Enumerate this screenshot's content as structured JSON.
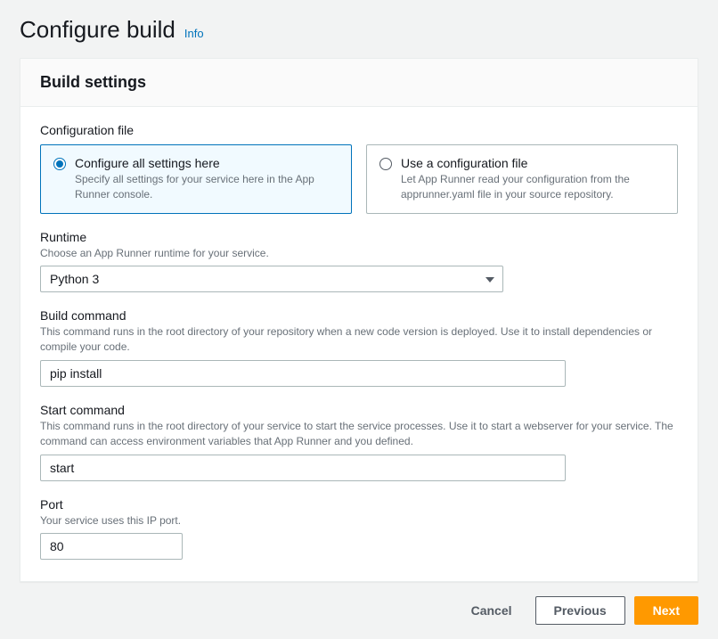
{
  "header": {
    "title": "Configure build",
    "info_label": "Info"
  },
  "card": {
    "title": "Build settings"
  },
  "config_file": {
    "label": "Configuration file",
    "option_a": {
      "title": "Configure all settings here",
      "desc": "Specify all settings for your service here in the App Runner console."
    },
    "option_b": {
      "title": "Use a configuration file",
      "desc": "Let App Runner read your configuration from the apprunner.yaml file in your source repository."
    }
  },
  "runtime": {
    "label": "Runtime",
    "desc": "Choose an App Runner runtime for your service.",
    "value": "Python 3"
  },
  "build_command": {
    "label": "Build command",
    "desc": "This command runs in the root directory of your repository when a new code version is deployed. Use it to install dependencies or compile your code.",
    "value": "pip install"
  },
  "start_command": {
    "label": "Start command",
    "desc": "This command runs in the root directory of your service to start the service processes. Use it to start a webserver for your service. The command can access environment variables that App Runner and you defined.",
    "value": "start"
  },
  "port": {
    "label": "Port",
    "desc": "Your service uses this IP port.",
    "value": "80"
  },
  "actions": {
    "cancel": "Cancel",
    "previous": "Previous",
    "next": "Next"
  }
}
